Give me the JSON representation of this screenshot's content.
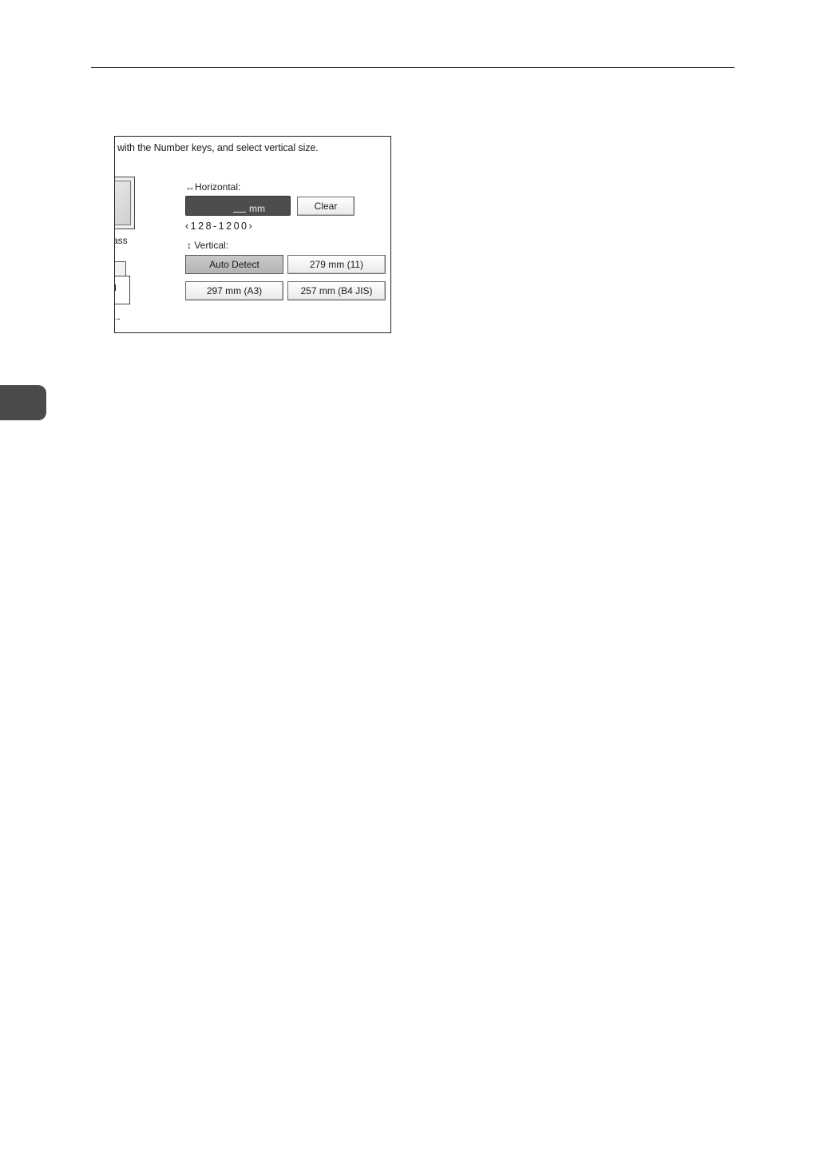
{
  "panel": {
    "instruction": "with the Number keys, and select vertical size.",
    "illustration_label": "ass",
    "illustration_arrow": "→",
    "horizontal": {
      "label": "↔Horizontal:",
      "value": "",
      "unit": "mm",
      "clear_label": "Clear",
      "range": "‹128-1200›"
    },
    "vertical": {
      "label": "↕ Vertical:",
      "options": [
        {
          "label": "Auto Detect",
          "selected": true
        },
        {
          "label": "279 mm (11)",
          "selected": false
        },
        {
          "label": "297 mm (A3)",
          "selected": false
        },
        {
          "label": "257 mm (B4 JIS)",
          "selected": false
        }
      ]
    }
  },
  "colors": {
    "input_bg": "#4d4d4d",
    "selected_bg": "#bdbdbd",
    "side_tab": "#4a4a4a"
  }
}
